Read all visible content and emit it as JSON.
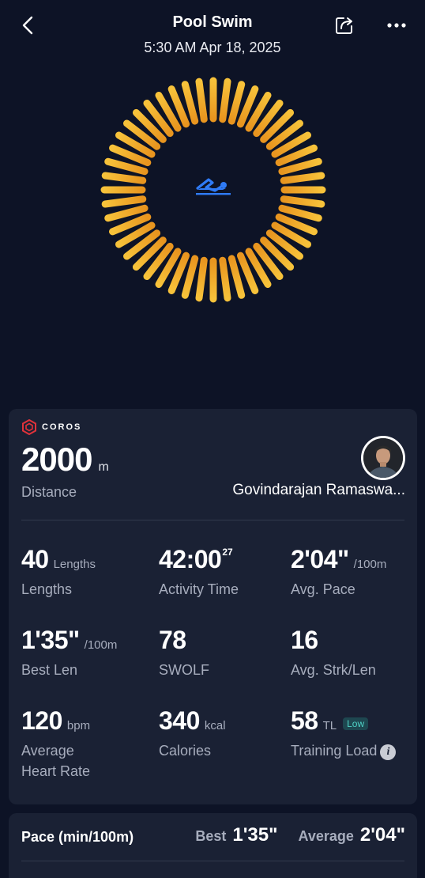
{
  "header": {
    "title": "Pool Swim",
    "datetime": "5:30 AM Apr 18, 2025",
    "back_icon": "chevron-left-icon",
    "share_icon": "share-icon",
    "more_icon": "more-horizontal-icon"
  },
  "ring": {
    "icon": "pool-swim-icon",
    "colors": {
      "inner": "#e8951f",
      "outer": "#f7c23a",
      "swim_icon": "#2f7bf6"
    }
  },
  "summary": {
    "brand": "COROS",
    "distance_value": "2000",
    "distance_unit": "m",
    "distance_label": "Distance",
    "user_name": "Govindarajan Ramaswa...",
    "metrics": {
      "lengths": {
        "value": "40",
        "unit": "Lengths",
        "label": "Lengths"
      },
      "activity_time": {
        "value": "42:00",
        "sup": "27",
        "label": "Activity Time"
      },
      "avg_pace": {
        "value": "2'04\"",
        "unit": "/100m",
        "label": "Avg. Pace"
      },
      "best_len": {
        "value": "1'35\"",
        "unit": "/100m",
        "label": "Best Len"
      },
      "swolf": {
        "value": "78",
        "label": "SWOLF"
      },
      "avg_strk": {
        "value": "16",
        "label": "Avg. Strk/Len"
      },
      "heart_rate": {
        "value": "120",
        "unit": "bpm",
        "label_line1": "Average",
        "label_line2": "Heart Rate"
      },
      "calories": {
        "value": "340",
        "unit": "kcal",
        "label": "Calories"
      },
      "training_load": {
        "value": "58",
        "unit": "TL",
        "badge": "Low",
        "label": "Training Load",
        "info_icon": "info-icon"
      }
    }
  },
  "pace_section": {
    "title": "Pace (min/100m)",
    "best_label": "Best",
    "best_value": "1'35\"",
    "avg_label": "Average",
    "avg_value": "2'04\""
  }
}
